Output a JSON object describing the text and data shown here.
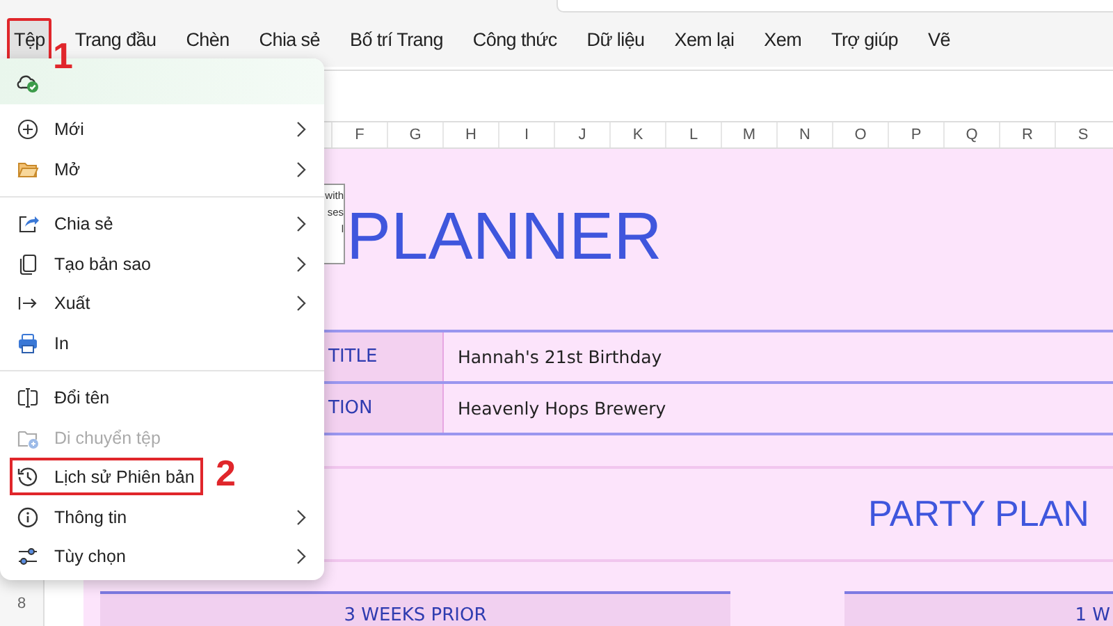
{
  "ribbon": {
    "tabs": [
      {
        "label": "Tệp",
        "selected": true,
        "outlined": true
      },
      {
        "label": "Trang đầu",
        "selected": false,
        "outlined": false
      },
      {
        "label": "Chèn",
        "selected": false,
        "outlined": false
      },
      {
        "label": "Chia sẻ",
        "selected": false,
        "outlined": false
      },
      {
        "label": "Bố trí Trang",
        "selected": false,
        "outlined": false
      },
      {
        "label": "Công thức",
        "selected": false,
        "outlined": false
      },
      {
        "label": "Dữ liệu",
        "selected": false,
        "outlined": false
      },
      {
        "label": "Xem lại",
        "selected": false,
        "outlined": false
      },
      {
        "label": "Xem",
        "selected": false,
        "outlined": false
      },
      {
        "label": "Trợ giúp",
        "selected": false,
        "outlined": false
      },
      {
        "label": "Vẽ",
        "selected": false,
        "outlined": false
      }
    ]
  },
  "file_menu": {
    "items": [
      {
        "kind": "status"
      },
      {
        "kind": "item",
        "label": "Mới",
        "submenu": true,
        "disabled": false,
        "outlined": false
      },
      {
        "kind": "item",
        "label": "Mở",
        "submenu": true,
        "disabled": false,
        "outlined": false
      },
      {
        "kind": "divider"
      },
      {
        "kind": "item",
        "label": "Chia sẻ",
        "submenu": true,
        "disabled": false,
        "outlined": false
      },
      {
        "kind": "item",
        "label": "Tạo bản sao",
        "submenu": true,
        "disabled": false,
        "outlined": false
      },
      {
        "kind": "item",
        "label": "Xuất",
        "submenu": true,
        "disabled": false,
        "outlined": false
      },
      {
        "kind": "item",
        "label": "In",
        "submenu": false,
        "disabled": false,
        "outlined": false
      },
      {
        "kind": "divider"
      },
      {
        "kind": "item",
        "label": "Đổi tên",
        "submenu": false,
        "disabled": false,
        "outlined": false
      },
      {
        "kind": "item",
        "label": "Di chuyển tệp",
        "submenu": false,
        "disabled": true,
        "outlined": false
      },
      {
        "kind": "item",
        "label": "Lịch sử Phiên bản",
        "submenu": false,
        "disabled": false,
        "outlined": true
      },
      {
        "kind": "item",
        "label": "Thông tin",
        "submenu": true,
        "disabled": false,
        "outlined": false
      },
      {
        "kind": "item",
        "label": "Tùy chọn",
        "submenu": true,
        "disabled": false,
        "outlined": false
      }
    ]
  },
  "annotations": [
    "1",
    "2"
  ],
  "sheet": {
    "columns": [
      "F",
      "G",
      "H",
      "I",
      "J",
      "K",
      "L",
      "M",
      "N",
      "O",
      "P",
      "Q",
      "R",
      "S"
    ],
    "rows": [
      "8"
    ],
    "note_lines": [
      "with",
      "ses",
      "l"
    ],
    "title": "PLANNER",
    "info": [
      {
        "label": "TITLE",
        "value": "Hannah's 21st Birthday"
      },
      {
        "label": "TION",
        "value": "Heavenly Hops Brewery"
      }
    ],
    "heading": "PARTY PLAN",
    "sections": [
      "3 WEEKS PRIOR",
      "1 W"
    ]
  }
}
